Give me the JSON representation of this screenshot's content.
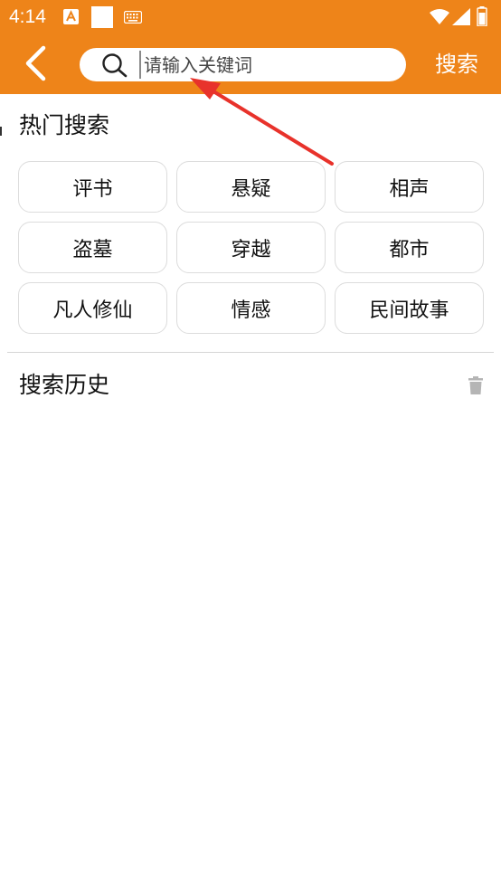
{
  "status_bar": {
    "time": "4:14",
    "icons": [
      "a-notification-icon",
      "square-notification-icon",
      "keyboard-icon",
      "wifi-icon",
      "signal-icon",
      "battery-icon"
    ]
  },
  "header": {
    "back_icon": "chevron-left-icon",
    "search_icon": "search-icon",
    "search_placeholder": "请输入关键词",
    "search_value": "",
    "search_button_label": "搜索"
  },
  "hot_search": {
    "title": "热门搜索",
    "tags": [
      "评书",
      "悬疑",
      "相声",
      "盗墓",
      "穿越",
      "都市",
      "凡人修仙",
      "情感",
      "民间故事"
    ]
  },
  "history": {
    "title": "搜索历史",
    "clear_icon": "trash-icon"
  },
  "colors": {
    "accent": "#ee8419",
    "annotation_arrow": "#e8322b",
    "tag_border": "#dcdcdc",
    "trash_icon": "#b5b5b5"
  }
}
